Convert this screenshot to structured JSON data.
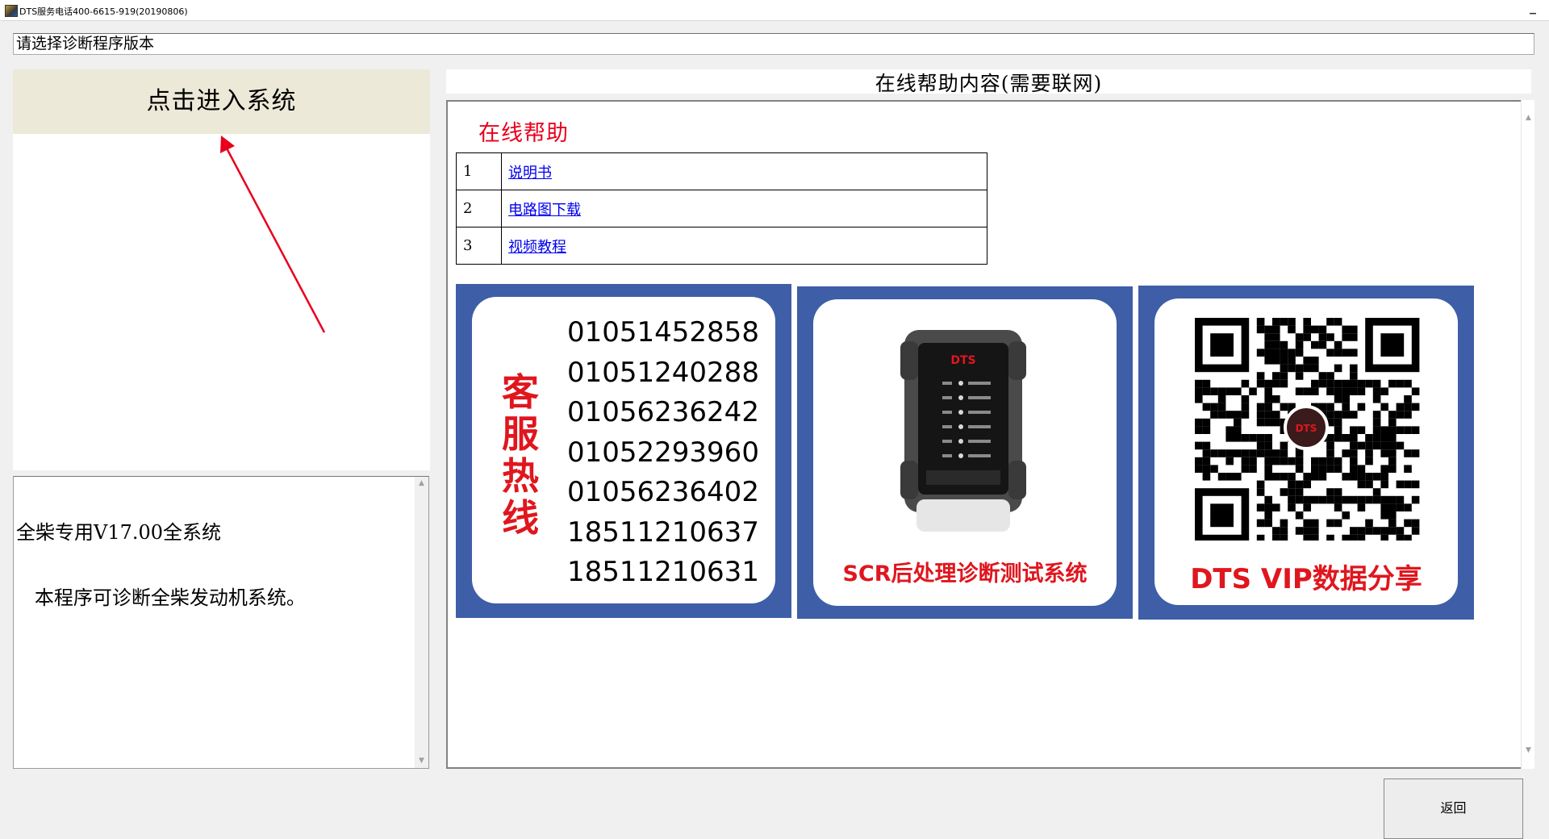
{
  "window": {
    "title": "DTS服务电话400-6615-919(20190806)",
    "minimize_glyph": "▁"
  },
  "version_field": {
    "value": "请选择诊断程序版本"
  },
  "left_panel": {
    "enter_button_label": "点击进入系统",
    "description_lines": [
      "全柴专用V17.00全系统",
      "   本程序可诊断全柴发动机系统。"
    ]
  },
  "help": {
    "header": "在线帮助内容(需要联网)",
    "title": "在线帮助",
    "items": [
      {
        "num": "1",
        "label": "说明书"
      },
      {
        "num": "2",
        "label": "电路图下载"
      },
      {
        "num": "3",
        "label": "视频教程"
      }
    ]
  },
  "banners": {
    "hotline": {
      "title_chars": [
        "客",
        "服",
        "热",
        "线"
      ],
      "numbers": [
        "01051452858",
        "01051240288",
        "01056236242",
        "01052293960",
        "01056236402",
        "18511210637",
        "18511210631"
      ]
    },
    "device": {
      "brand": "DTS",
      "caption": "SCR后处理诊断测试系统"
    },
    "vip": {
      "brand": "DTS",
      "caption": "DTS VIP数据分享"
    }
  },
  "footer": {
    "back_label": "返回"
  },
  "icons": {
    "scroll_up": "▲",
    "scroll_down": "▼"
  },
  "colors": {
    "accent_red": "#e0161e",
    "banner_blue": "#3e5ea7",
    "button_beige": "#ece9d8",
    "link_blue": "#0000ee"
  }
}
